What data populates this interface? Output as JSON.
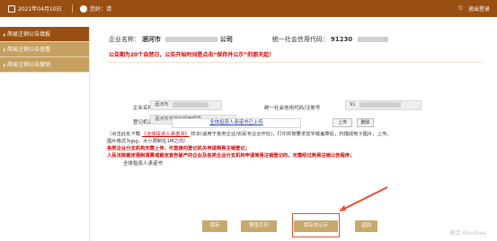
{
  "header": {
    "date": "2021年04月10日",
    "user_label": "您好：请",
    "logout": "退出登录"
  },
  "sidebar": {
    "items": [
      {
        "label": "简易注销公告填报"
      },
      {
        "label": "简易注销公告查看"
      },
      {
        "label": "简易注销公告撤销"
      }
    ]
  },
  "summary": {
    "company_label": "企业名称：",
    "company_value": "酒河市",
    "company_suffix": "公司",
    "credit_label": "统一社会信用代码：",
    "credit_value": "91230"
  },
  "notice": "公告期为20个自然日，公告开始时间是点击“保存并公示”的那天起！",
  "form": {
    "company_name_label": "企业名称",
    "company_name_value": "酒河市",
    "credit_code_label": "统一社会信用代码/注册号",
    "credit_code_value": "91",
    "registration_authority_label": "登记机关",
    "registration_authority_value": "酒河市市场监督管理局"
  },
  "upload": {
    "label": "全体投资人承诺书",
    "link": "全体投资人承诺书已上传",
    "upload_button": "上传",
    "delete_button": "删除"
  },
  "help": {
    "line1_prefix": "（点击此处下载",
    "line1_link": "《全体投资人承诺书》",
    "line1_suffix": "样本(适用于各类企业/农民专业合作社)，打印并按要求签字或盖章后，扫描成电子图片，上传。",
    "line2": "图片格式为jpg，大小限制在1M之内）",
    "line3": "各类企业分支机构无需上传，可直接向登记机关申请简易注销登记；",
    "line4": "人民法院裁定强制清算或裁定宣告破产的企业及各类企业分支机构申请简易注销登记的，无需经过简易注销公告程序；"
  },
  "buttons": {
    "save": "保存",
    "preview": "预览打印",
    "save_publish": "保存并公示",
    "back": "返回"
  },
  "watermark": "激活 Windows"
}
